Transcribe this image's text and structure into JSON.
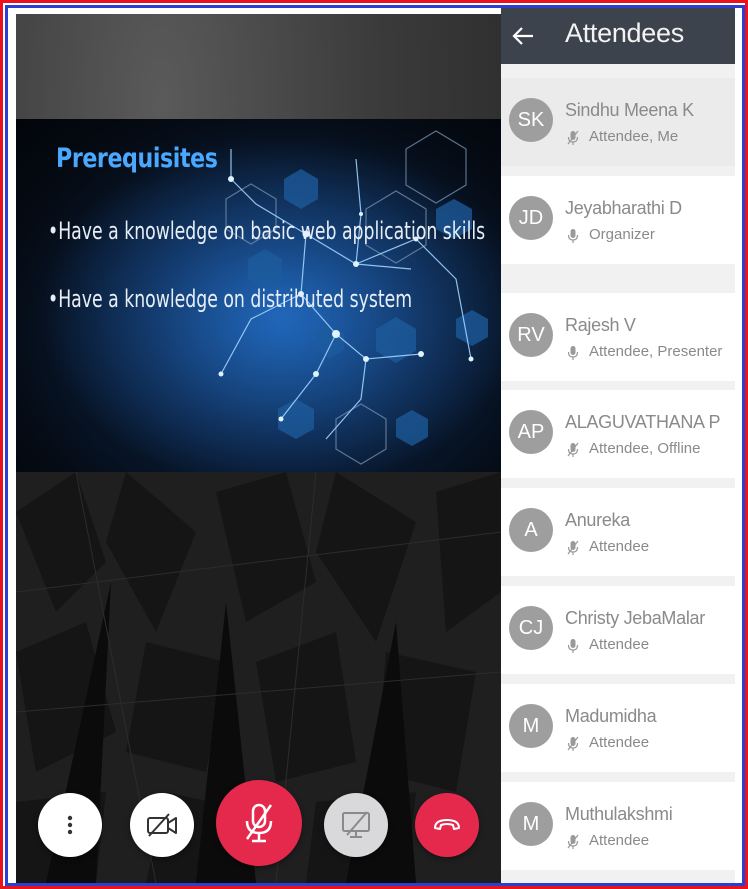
{
  "header": {
    "title": "Attendees"
  },
  "slide": {
    "title": "Prerequisites",
    "bullets": [
      "•Have a knowledge on basic web application skills",
      "•Have a knowledge on distributed system"
    ]
  },
  "attendees": [
    {
      "initials": "SK",
      "name": "Sindhu Meena K",
      "role": "Attendee, Me",
      "mic": "muted",
      "highlighted": true
    },
    {
      "initials": "JD",
      "name": "Jeyabharathi D",
      "role": "Organizer",
      "mic": "on"
    },
    {
      "initials": "RV",
      "name": "Rajesh V",
      "role": "Attendee, Presenter",
      "mic": "on"
    },
    {
      "initials": "AP",
      "name": "ALAGUVATHANA P",
      "role": "Attendee, Offline",
      "mic": "muted"
    },
    {
      "initials": "A",
      "name": "Anureka",
      "role": "Attendee",
      "mic": "muted"
    },
    {
      "initials": "CJ",
      "name": "Christy JebaMalar",
      "role": "Attendee",
      "mic": "on"
    },
    {
      "initials": "M",
      "name": "Madumidha",
      "role": "Attendee",
      "mic": "muted"
    },
    {
      "initials": "M",
      "name": "Muthulakshmi",
      "role": "Attendee",
      "mic": "muted"
    }
  ],
  "controls": [
    {
      "icon": "more-vertical-icon"
    },
    {
      "icon": "video-off-icon"
    },
    {
      "icon": "mic-off-icon"
    },
    {
      "icon": "screen-share-off-icon"
    },
    {
      "icon": "hang-up-icon"
    }
  ],
  "colors": {
    "accent_red": "#e5294d",
    "header_bg": "#3d434d",
    "slide_title": "#4aa8ff",
    "avatar_bg": "#9e9e9e",
    "frame_red": "#e8131c",
    "frame_blue": "#2a3fd0"
  }
}
